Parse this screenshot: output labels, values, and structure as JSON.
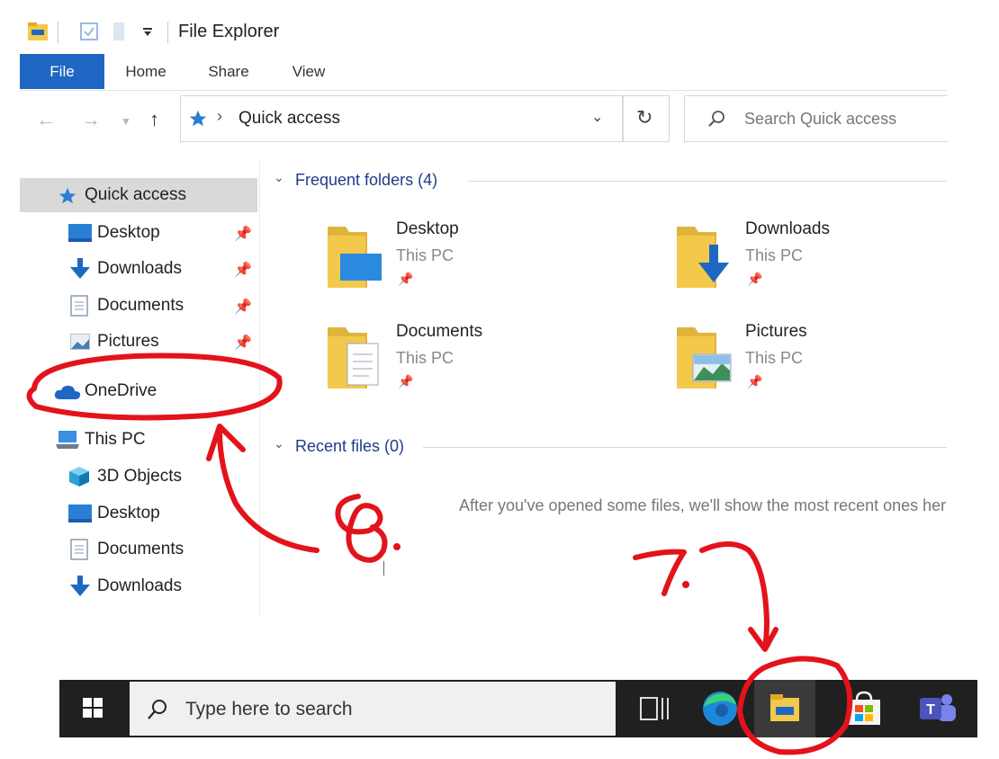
{
  "window": {
    "title": "File Explorer",
    "tabs": [
      "File",
      "Home",
      "Share",
      "View"
    ]
  },
  "address": {
    "location": "Quick access",
    "search_placeholder": "Search Quick access"
  },
  "nav_pane": {
    "items": [
      {
        "label": "Quick access",
        "icon": "star-icon",
        "pinned": false
      },
      {
        "label": "Desktop",
        "icon": "desktop-icon",
        "pinned": true
      },
      {
        "label": "Downloads",
        "icon": "download-arrow-icon",
        "pinned": true
      },
      {
        "label": "Documents",
        "icon": "document-icon",
        "pinned": true
      },
      {
        "label": "Pictures",
        "icon": "pictures-icon",
        "pinned": true
      },
      {
        "label": "OneDrive",
        "icon": "cloud-icon",
        "pinned": false
      },
      {
        "label": "This PC",
        "icon": "computer-icon",
        "pinned": false
      },
      {
        "label": "3D Objects",
        "icon": "cube-icon",
        "pinned": false
      },
      {
        "label": "Desktop",
        "icon": "desktop-icon",
        "pinned": false
      },
      {
        "label": "Documents",
        "icon": "document-icon",
        "pinned": false
      },
      {
        "label": "Downloads",
        "icon": "download-arrow-icon",
        "pinned": false
      }
    ]
  },
  "content": {
    "frequent_header": "Frequent folders (4)",
    "recent_header": "Recent files (0)",
    "folders": [
      {
        "name": "Desktop",
        "location": "This PC",
        "overlay": "desktop"
      },
      {
        "name": "Downloads",
        "location": "This PC",
        "overlay": "download"
      },
      {
        "name": "Documents",
        "location": "This PC",
        "overlay": "document"
      },
      {
        "name": "Pictures",
        "location": "This PC",
        "overlay": "picture"
      }
    ],
    "empty_message": "After you've opened some files, we'll show the most recent ones here."
  },
  "taskbar": {
    "search_placeholder": "Type here to search",
    "icons": [
      "windows-start-icon",
      "task-view-icon",
      "edge-icon",
      "file-explorer-icon",
      "store-icon",
      "teams-icon"
    ]
  },
  "annotations": {
    "step_8": "8.",
    "step_7": "7.",
    "ink_color": "#e3131b"
  },
  "colors": {
    "accent": "#1f67c2",
    "folder_yellow": "#f3c94c",
    "taskbar": "#202020",
    "section_header": "#1f3c88"
  }
}
